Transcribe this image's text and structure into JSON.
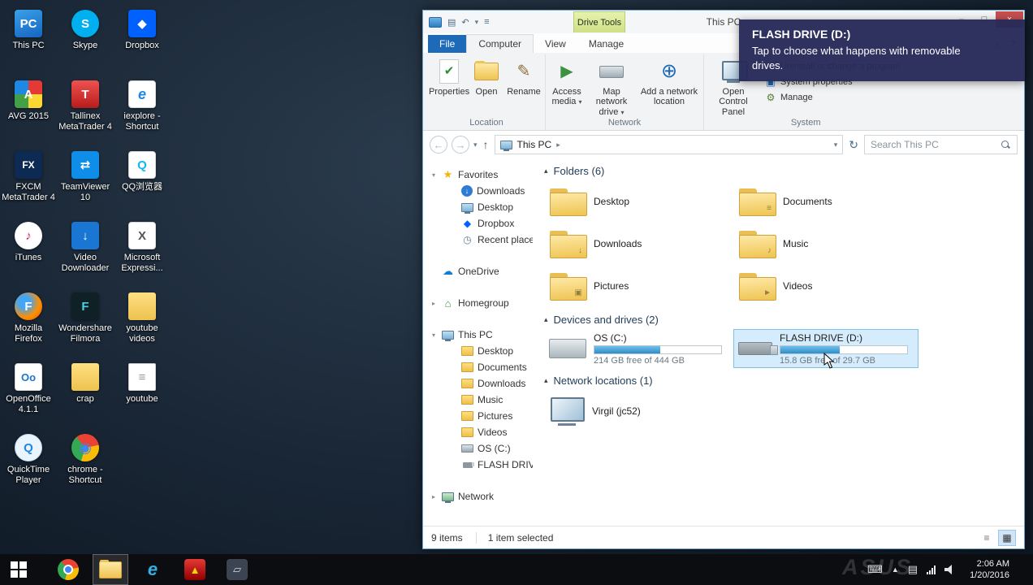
{
  "desktop": {
    "icons": [
      {
        "label": "This PC",
        "glyph": "PC",
        "style": "background:linear-gradient(160deg,#3aa0e8,#1565c0)"
      },
      {
        "label": "AVG 2015",
        "glyph": "A",
        "style": "background:conic-gradient(#e53935 0 25%,#fdd835 0 50%,#43a047 0 75%,#1e88e5 0)"
      },
      {
        "label": "FXCM MetaTrader 4",
        "glyph": "FX",
        "style": "background:#0d2a52;font-size:12px"
      },
      {
        "label": "iTunes",
        "glyph": "♪",
        "style": "background:radial-gradient(circle,#ffffff 60%,#e4e4e4);color:#d81b60;border-radius:50%"
      },
      {
        "label": "Mozilla Firefox",
        "glyph": "F",
        "style": "background:radial-gradient(circle at 35% 35%,#42a5f5 22%,#ff8f00 60%,#e65100);border-radius:50%"
      },
      {
        "label": "OpenOffice 4.1.1",
        "glyph": "Oo",
        "style": "background:#ffffff;color:#1976d2;border:1px solid #d5d5d5;font-size:13px"
      },
      {
        "label": "QuickTime Player",
        "glyph": "Q",
        "style": "background:#eaf4fd;color:#1e88e5;border-radius:50%;border:1px solid #bcd8ef"
      },
      {
        "label": "Skype",
        "glyph": "S",
        "style": "background:#00aff0;border-radius:50%"
      },
      {
        "label": "Tallinex MetaTrader 4",
        "glyph": "T",
        "style": "background:linear-gradient(#ef5350,#b71c1c)"
      },
      {
        "label": "TeamViewer 10",
        "glyph": "⇄",
        "style": "background:#0e8ee9"
      },
      {
        "label": "Video Downloader",
        "glyph": "↓",
        "style": "background:#1976d2"
      },
      {
        "label": "Wondershare Filmora",
        "glyph": "F",
        "style": "background:#102027;color:#4dd0e1"
      },
      {
        "label": "crap",
        "glyph": "",
        "style": "background:linear-gradient(#ffe082,#edc24f);border-radius:3px"
      },
      {
        "label": "chrome - Shortcut",
        "glyph": "◉",
        "style": "background:conic-gradient(from -40deg,#ea4335 0 33%,#fbbc05 0 66%,#34a853 0);color:#4285f4;border-radius:50%;font-size:18px"
      },
      {
        "label": "Dropbox",
        "glyph": "◆",
        "style": "background:#0061ff"
      },
      {
        "label": "iexplore - Shortcut",
        "glyph": "e",
        "style": "background:#ffffff;color:#1e88e5;border:1px solid #d5d5d5;font-style:italic;font-size:18px"
      },
      {
        "label": "QQ浏览器",
        "glyph": "Q",
        "style": "background:#ffffff;color:#12b7f5;border:1px solid #d5d5d5"
      },
      {
        "label": "Microsoft Expressi...",
        "glyph": "X",
        "style": "background:#ffffff;color:#555555;border:1px solid #d5d5d5"
      },
      {
        "label": "youtube videos",
        "glyph": "",
        "style": "background:linear-gradient(#ffe082,#edc24f);border-radius:3px"
      },
      {
        "label": "youtube",
        "glyph": "≡",
        "style": "background:#ffffff;color:#9a9a9a;border:1px solid #cccccc;border-radius:2px"
      }
    ]
  },
  "explorer": {
    "title": "This PC",
    "drive_tools_label": "Drive Tools",
    "qat": {
      "menu_glyph": "≡",
      "icon1_glyph": "▤",
      "icon2_glyph": "↶",
      "dropdown_glyph": "▾"
    },
    "window_buttons": {
      "minimize": "–",
      "maximize": "□",
      "close": "×"
    },
    "tabs": [
      {
        "label": "File",
        "cls": "file"
      },
      {
        "label": "Computer",
        "cls": "active"
      },
      {
        "label": "View"
      },
      {
        "label": "Manage"
      }
    ],
    "tabs_right": {
      "collapse": "∧",
      "help": "?"
    },
    "ribbon": {
      "properties_label": "Properties",
      "open_label": "Open",
      "rename_label": "Rename",
      "access_media_label": "Access media",
      "map_drive_label": "Map network drive",
      "add_location_label": "Add a network location",
      "control_panel_label": "Open Control Panel",
      "uninstall_label": "Uninstall or change a program",
      "sysprops_label": "System properties",
      "manage_label": "Manage",
      "groups": [
        {
          "label": "Location"
        },
        {
          "label": "Network"
        },
        {
          "label": "System"
        }
      ],
      "icons": {
        "properties": "✔",
        "rename": "✎",
        "access_media": "▶",
        "add_location": "⊕",
        "uninstall": "☒",
        "sysprops": "▣",
        "manage": "⚙",
        "dropdown": "▾"
      }
    },
    "address": {
      "back_glyph": "←",
      "forward_glyph": "→",
      "recent_glyph": "▾",
      "up_glyph": "↑",
      "location": "This PC",
      "crumb_arrow": "▸",
      "dropdown_glyph": "▾",
      "refresh_glyph": "↻",
      "search_placeholder": "Search This PC"
    },
    "nav": [
      {
        "label": "Favorites",
        "exp": "▾",
        "icon": "ic-star",
        "glyph": "★",
        "row_class": "lvl0"
      },
      {
        "label": "Downloads",
        "icon": "ic-dl",
        "glyph": "↓",
        "row_class": "lvl1"
      },
      {
        "label": "Desktop",
        "icon": "ic-pc",
        "row_class": "lvl1"
      },
      {
        "label": "Dropbox",
        "icon": "ic-dropbox",
        "glyph": "◆",
        "row_class": "lvl1"
      },
      {
        "label": "Recent places",
        "icon": "ic-recent",
        "glyph": "◷",
        "row_class": "lvl1"
      },
      {
        "label": "OneDrive",
        "icon": "ic-cloud",
        "glyph": "☁",
        "row_class": "lvl0 gap"
      },
      {
        "label": "Homegroup",
        "exp": "▸",
        "icon": "ic-home",
        "glyph": "⌂",
        "row_class": "lvl0 gap"
      },
      {
        "label": "This PC",
        "exp": "▾",
        "icon": "ic-pc",
        "row_class": "lvl0 gap"
      },
      {
        "label": "Desktop",
        "icon": "mini-folder",
        "row_class": "lvl1"
      },
      {
        "label": "Documents",
        "icon": "mini-folder",
        "row_class": "lvl1"
      },
      {
        "label": "Downloads",
        "icon": "mini-folder",
        "row_class": "lvl1"
      },
      {
        "label": "Music",
        "icon": "mini-folder",
        "row_class": "lvl1"
      },
      {
        "label": "Pictures",
        "icon": "mini-folder",
        "row_class": "lvl1"
      },
      {
        "label": "Videos",
        "icon": "mini-folder",
        "row_class": "lvl1"
      },
      {
        "label": "OS (C:)",
        "icon": "ic-hdd",
        "row_class": "lvl1"
      },
      {
        "label": "FLASH DRIVE (D",
        "icon": "ic-usb",
        "row_class": "lvl1"
      },
      {
        "label": "Network",
        "exp": "▸",
        "icon": "ic-net",
        "row_class": "lvl0 gap"
      }
    ],
    "content": {
      "tri": "▴",
      "groups": [
        {
          "title": "Folders (6)"
        },
        {
          "title": "Devices and drives (2)"
        },
        {
          "title": "Network locations (1)"
        }
      ],
      "folders": [
        {
          "name": "Desktop",
          "overlay": ""
        },
        {
          "name": "Documents",
          "overlay": "≡"
        },
        {
          "name": "Downloads",
          "overlay": "↓"
        },
        {
          "name": "Music",
          "overlay": "♪"
        },
        {
          "name": "Pictures",
          "overlay": "▣"
        },
        {
          "name": "Videos",
          "overlay": "►"
        }
      ],
      "drives": [
        {
          "name": "OS (C:)",
          "caption": "214 GB free of 444 GB",
          "fill_style": "width:52%",
          "icon": "big-hdd"
        },
        {
          "name": "FLASH DRIVE (D:)",
          "caption": "15.8 GB free of 29.7 GB",
          "fill_style": "width:47%",
          "icon": "big-usb",
          "sel_class": "selected"
        }
      ],
      "network_items": [
        {
          "name": "Virgil (jc52)"
        }
      ]
    },
    "status": {
      "items": "9 items",
      "selected": "1 item selected",
      "view_details": "≡",
      "view_tiles": "▦"
    }
  },
  "notification": {
    "title": "FLASH DRIVE (D:)",
    "message": "Tap to choose what happens with removable drives."
  },
  "taskbar": {
    "apps": {
      "ie": "e",
      "mt": "▲",
      "win": "▱"
    },
    "tray": {
      "keyboard_glyph": "⌨",
      "show_hidden_glyph": "▲",
      "display_glyph": "▤"
    },
    "clock_time": "2:06 AM",
    "clock_date": "1/20/2016",
    "watermark": "ASUS"
  }
}
